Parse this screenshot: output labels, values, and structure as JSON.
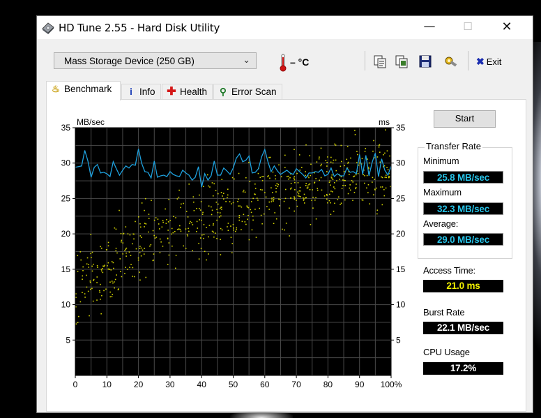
{
  "window": {
    "title": "HD Tune 2.55 - Hard Disk Utility",
    "minimize_glyph": "—",
    "maximize_glyph": "☐",
    "close_glyph": "✕"
  },
  "toolbar": {
    "drive_select": "Mass Storage Device (250 GB)",
    "temperature": "– °C",
    "exit_label": "Exit",
    "buttons": [
      "copy-text-icon",
      "copy-image-icon",
      "save-icon",
      "options-icon"
    ]
  },
  "tabs": [
    {
      "label": "Benchmark",
      "icon": "benchmark-icon",
      "active": true
    },
    {
      "label": "Info",
      "icon": "info-icon",
      "active": false
    },
    {
      "label": "Health",
      "icon": "health-cross-icon",
      "active": false
    },
    {
      "label": "Error Scan",
      "icon": "magnifier-icon",
      "active": false
    }
  ],
  "benchmark": {
    "start_label": "Start",
    "transfer_rate_title": "Transfer Rate",
    "minimum_label": "Minimum",
    "minimum_value": "25.8 MB/sec",
    "maximum_label": "Maximum",
    "maximum_value": "32.3 MB/sec",
    "average_label": "Average:",
    "average_value": "29.0 MB/sec",
    "access_time_label": "Access Time:",
    "access_time_value": "21.0 ms",
    "burst_rate_label": "Burst Rate",
    "burst_rate_value": "22.1 MB/sec",
    "cpu_usage_label": "CPU Usage",
    "cpu_usage_value": "17.2%"
  },
  "colors": {
    "transfer_line": "#1ea0dc",
    "access_points": "#d4d400",
    "plot_background": "#000000",
    "grid": "#4a4a4a",
    "cyan_value": "#27c3e8",
    "yellow_value": "#f2f200"
  },
  "chart_data": {
    "type": "line",
    "ylabel_left": "MB/sec",
    "ylabel_right": "ms",
    "xlim": [
      0,
      100
    ],
    "ylim": [
      0,
      35
    ],
    "x_ticks": [
      "0",
      "10",
      "20",
      "30",
      "40",
      "50",
      "60",
      "70",
      "80",
      "90",
      "100%"
    ],
    "y_ticks": [
      "35",
      "30",
      "25",
      "20",
      "15",
      "10",
      "5"
    ],
    "y_ticks_right": [
      "35",
      "30",
      "25",
      "20",
      "15",
      "10",
      "5"
    ],
    "grid": true,
    "series": [
      {
        "type": "line",
        "x": [
          0,
          2,
          3,
          4,
          5,
          6,
          7,
          8,
          9,
          10,
          11,
          12,
          13,
          14,
          15,
          16,
          17,
          18,
          19,
          20,
          21,
          22,
          23,
          24,
          25,
          26,
          27,
          28,
          29,
          30,
          31,
          32,
          33,
          34,
          35,
          36,
          37,
          38,
          39,
          40,
          41,
          42,
          43,
          44,
          45,
          46,
          47,
          48,
          49,
          50,
          51,
          52,
          53,
          54,
          55,
          56,
          57,
          58,
          59,
          60,
          61,
          62,
          63,
          64,
          65,
          66,
          67,
          68,
          69,
          70,
          71,
          72,
          73,
          74,
          75,
          76,
          77,
          78,
          79,
          80,
          81,
          82,
          83,
          84,
          85,
          86,
          87,
          88,
          89,
          90,
          91,
          92,
          93,
          94,
          95,
          96,
          97,
          98,
          99,
          100
        ],
        "values": [
          29.4,
          29.6,
          31.8,
          30.3,
          28.0,
          29.4,
          29.8,
          28.6,
          28.7,
          28.5,
          28.1,
          30.2,
          29.2,
          28.3,
          29.0,
          29.6,
          29.3,
          29.8,
          29.7,
          32.0,
          30.0,
          28.8,
          28.7,
          27.9,
          30.3,
          28.0,
          28.2,
          28.3,
          28.1,
          28.8,
          28.4,
          28.2,
          28.1,
          29.0,
          28.6,
          28.3,
          27.6,
          28.0,
          29.5,
          26.6,
          28.5,
          27.6,
          28.2,
          30.3,
          28.3,
          28.3,
          29.3,
          28.9,
          28.4,
          29.3,
          30.7,
          31.3,
          30.2,
          30.4,
          31.0,
          28.6,
          28.7,
          29.2,
          30.9,
          31.9,
          30.2,
          28.8,
          29.6,
          28.9,
          28.4,
          28.7,
          29.0,
          28.6,
          28.4,
          29.2,
          28.8,
          28.4,
          27.9,
          28.6,
          28.6,
          28.8,
          28.7,
          29.1,
          28.2,
          28.4,
          29.3,
          28.1,
          28.5,
          28.2,
          28.2,
          29.3,
          28.7,
          28.8,
          28.5,
          31.2,
          28.4,
          31.1,
          28.2,
          30.1,
          31.4,
          28.1,
          30.6,
          29.0,
          28.3,
          29.6
        ]
      },
      {
        "type": "scatter",
        "trend_x": [
          0,
          10,
          20,
          30,
          40,
          50,
          60,
          70,
          80,
          90,
          100
        ],
        "trend_ms": [
          12.0,
          16.0,
          18.6,
          20.6,
          22.0,
          23.6,
          25.0,
          26.3,
          27.4,
          28.4,
          29.3
        ],
        "spread_ms": 4.5,
        "point_count": 650
      }
    ]
  }
}
